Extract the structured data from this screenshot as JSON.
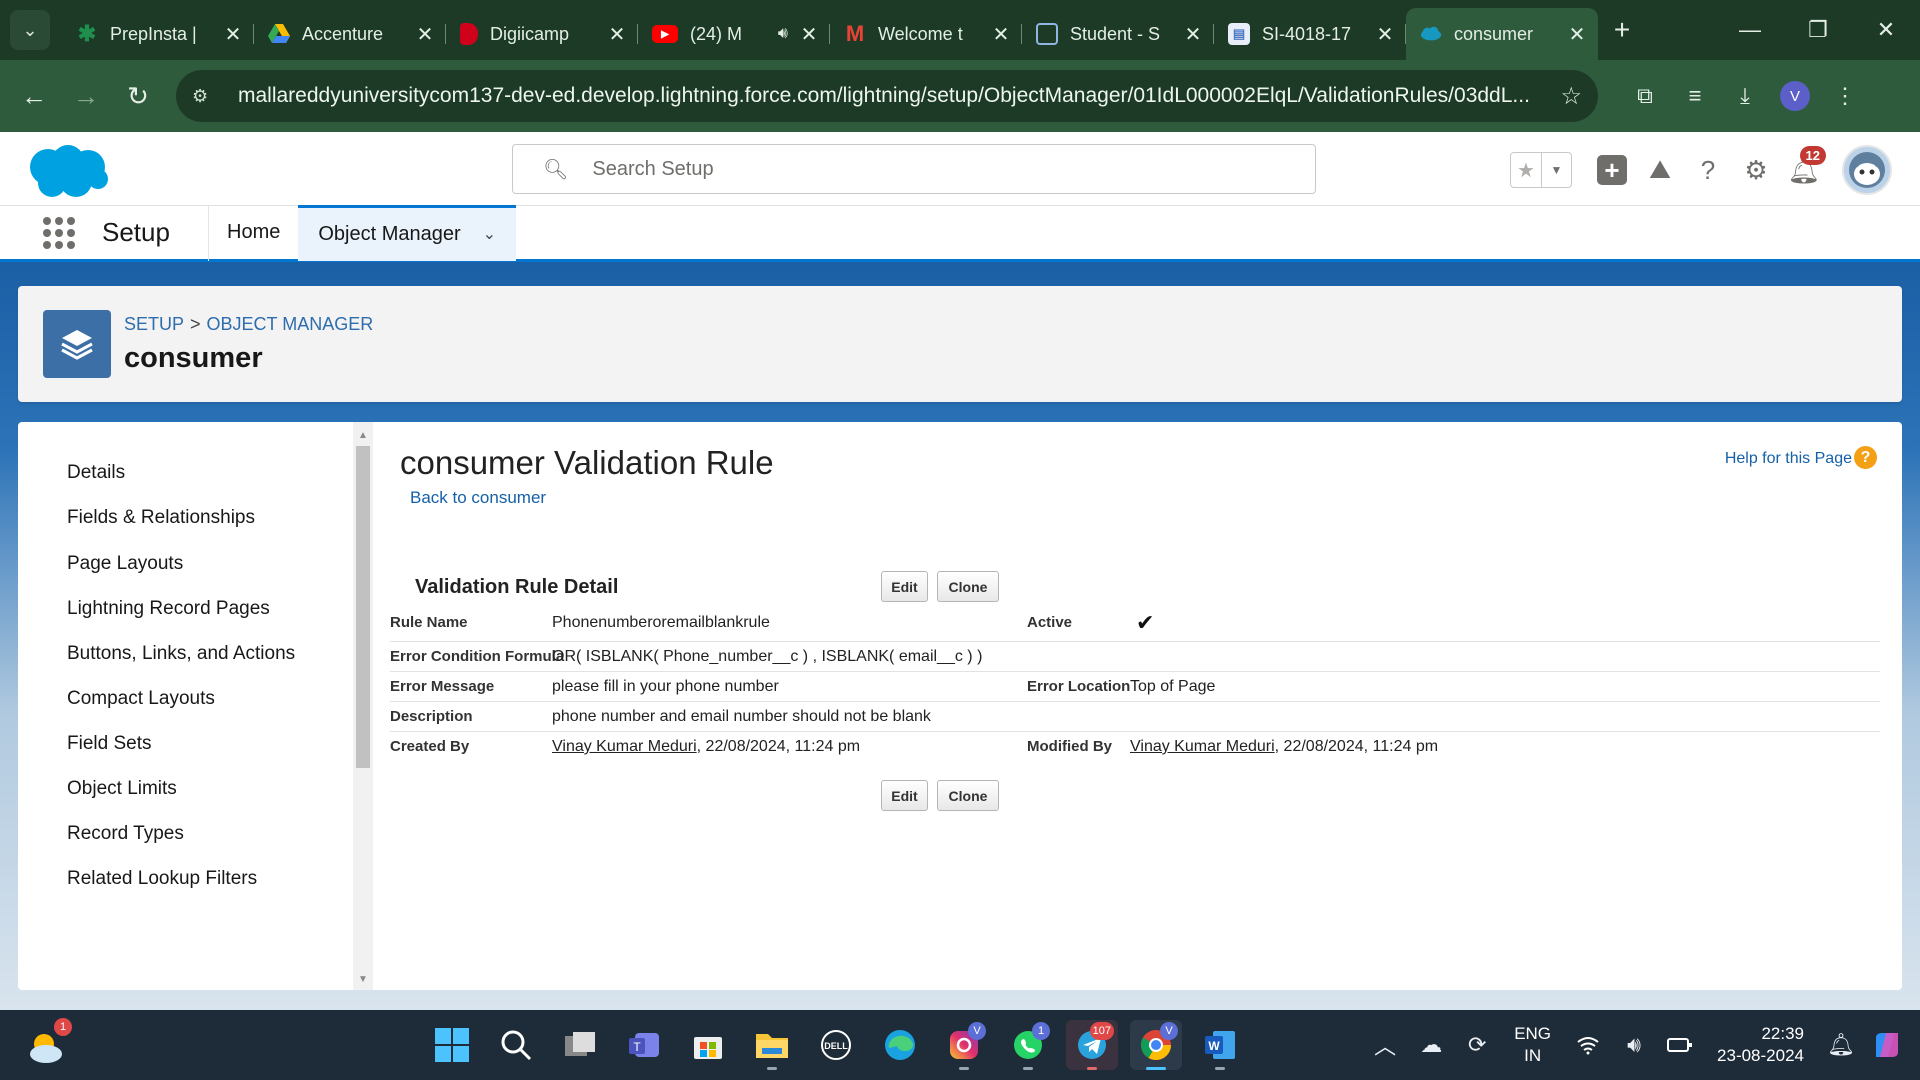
{
  "browser": {
    "tabs": [
      {
        "title": "PrepInsta |",
        "favicon_color": "#1f8f4e",
        "favicon_glyph": "✱"
      },
      {
        "title": "Accenture",
        "favicon_color": "#f4b400",
        "favicon_glyph": "▲"
      },
      {
        "title": "Digiicamp",
        "favicon_color": "#d0021b",
        "favicon_glyph": "◗"
      },
      {
        "title": "(24) M",
        "favicon_color": "#ff0000",
        "favicon_glyph": "▶"
      },
      {
        "title": "Welcome t",
        "favicon_color": "#ea4335",
        "favicon_glyph": "M"
      },
      {
        "title": "Student - S",
        "favicon_color": "#3b6ea5",
        "favicon_glyph": "▢"
      },
      {
        "title": "SI-4018-17",
        "favicon_color": "#4a78c2",
        "favicon_glyph": "▤"
      },
      {
        "title": "consumer",
        "favicon_color": "#1798c1",
        "favicon_glyph": "☁"
      }
    ],
    "url": "mallareddyuniversitycom137-dev-ed.develop.lightning.force.com/lightning/setup/ObjectManager/01IdL000002ElqL/ValidationRules/03ddL...",
    "profile_initial": "V"
  },
  "sf": {
    "search_placeholder": "Search Setup",
    "notification_count": "12",
    "app_name": "Setup",
    "nav": {
      "home": "Home",
      "object_manager": "Object Manager"
    },
    "breadcrumb": {
      "setup": "SETUP",
      "separator": ">",
      "object_manager": "OBJECT MANAGER"
    },
    "object_title": "consumer"
  },
  "sidebar": {
    "items": [
      "Details",
      "Fields & Relationships",
      "Page Layouts",
      "Lightning Record Pages",
      "Buttons, Links, and Actions",
      "Compact Layouts",
      "Field Sets",
      "Object Limits",
      "Record Types",
      "Related Lookup Filters"
    ]
  },
  "detail": {
    "title": "consumer Validation Rule",
    "back_link": "Back to consumer",
    "help_link": "Help for this Page",
    "section_title": "Validation Rule Detail",
    "edit_label": "Edit",
    "clone_label": "Clone",
    "rule_name_label": "Rule Name",
    "rule_name": "Phonenumberoremailblankrule",
    "active_label": "Active",
    "active_checked": true,
    "formula_label": "Error Condition Formula",
    "formula": "OR( ISBLANK( Phone_number__c ) , ISBLANK( email__c ) )",
    "error_message_label": "Error Message",
    "error_message": "please fill in your phone number",
    "error_location_label": "Error Location",
    "error_location": "Top of Page",
    "description_label": "Description",
    "description": "phone number and email number should not be blank",
    "created_by_label": "Created By",
    "created_by_name": "Vinay Kumar Meduri",
    "created_by_date": ", 22/08/2024, 11:24 pm",
    "modified_by_label": "Modified By",
    "modified_by_name": "Vinay Kumar Meduri",
    "modified_by_date": ", 22/08/2024, 11:24 pm"
  },
  "taskbar": {
    "weather_badge": "1",
    "apps": [
      "start",
      "search",
      "task-view",
      "teams",
      "store",
      "file-explorer",
      "dell",
      "edge",
      "instagram",
      "whatsapp",
      "telegram",
      "chrome",
      "word"
    ],
    "instagram_badge": "V",
    "whatsapp_badge": "1",
    "telegram_badge": "107",
    "chrome_badge": "V",
    "lang_top": "ENG",
    "lang_bottom": "IN",
    "time": "22:39",
    "date": "23-08-2024"
  },
  "colors": {
    "sf_blue": "#0176d3",
    "link_blue": "#1560a8",
    "browser_dark": "#1c3a26",
    "browser_mid": "#2f5b3d",
    "taskbar": "#1e2b38"
  }
}
